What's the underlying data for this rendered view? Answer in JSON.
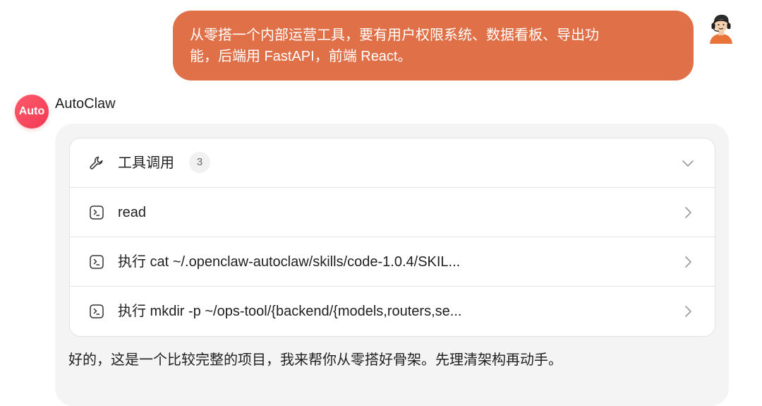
{
  "user_message": {
    "line1": "从零搭一个内部运营工具，要有用户权限系统、数据看板、导出功",
    "line2": "能，后端用 FastAPI，前端 React。"
  },
  "assistant": {
    "avatar_text": "Auto",
    "name": "AutoClaw",
    "tool_group": {
      "title": "工具调用",
      "count": "3",
      "items": [
        {
          "label": "read",
          "icon": "terminal-icon"
        },
        {
          "label": "执行 cat ~/.openclaw-autoclaw/skills/code-1.0.4/SKIL...",
          "icon": "terminal-icon"
        },
        {
          "label": "执行 mkdir -p ~/ops-tool/{backend/{models,routers,se...",
          "icon": "terminal-icon"
        }
      ]
    },
    "reply": "好的，这是一个比较完整的项目，我来帮你从零搭好骨架。先理清架构再动手。"
  },
  "colors": {
    "user_bubble": "#e07048",
    "bot_avatar": "#f03a55",
    "card_bg": "#f4f4f4"
  }
}
